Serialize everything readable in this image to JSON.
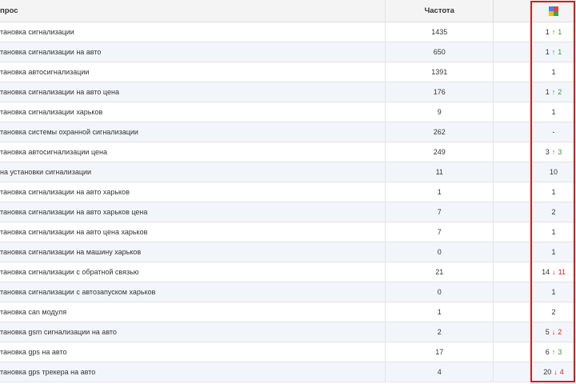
{
  "header": {
    "query_label": "прос",
    "frequency_label": "Частота"
  },
  "colors": {
    "up": "#2e9b2e",
    "down": "#d62020",
    "highlight": "#d71a1a"
  },
  "rows": [
    {
      "query": "тановка сигнализации",
      "freq": "1435",
      "pos": "1",
      "change_dir": "up",
      "change": "1"
    },
    {
      "query": "тановка сигнализации на авто",
      "freq": "650",
      "pos": "1",
      "change_dir": "up",
      "change": "1"
    },
    {
      "query": "тановка автосигнализации",
      "freq": "1391",
      "pos": "1",
      "change_dir": "",
      "change": ""
    },
    {
      "query": "тановка сигнализации на авто цена",
      "freq": "176",
      "pos": "1",
      "change_dir": "up",
      "change": "2"
    },
    {
      "query": "тановка сигнализации харьков",
      "freq": "9",
      "pos": "1",
      "change_dir": "",
      "change": ""
    },
    {
      "query": "тановка системы охранной сигнализации",
      "freq": "262",
      "pos": "-",
      "change_dir": "",
      "change": ""
    },
    {
      "query": "тановка автосигнализации цена",
      "freq": "249",
      "pos": "3",
      "change_dir": "up",
      "change": "3"
    },
    {
      "query": "на установки сигнализации",
      "freq": "11",
      "pos": "10",
      "change_dir": "",
      "change": ""
    },
    {
      "query": "тановка сигнализации на авто харьков",
      "freq": "1",
      "pos": "1",
      "change_dir": "",
      "change": ""
    },
    {
      "query": "тановка сигнализации на авто харьков цена",
      "freq": "7",
      "pos": "2",
      "change_dir": "",
      "change": ""
    },
    {
      "query": "тановка сигнализации на авто цена харьков",
      "freq": "7",
      "pos": "1",
      "change_dir": "",
      "change": ""
    },
    {
      "query": "тановка сигнализации на машину харьков",
      "freq": "0",
      "pos": "1",
      "change_dir": "",
      "change": ""
    },
    {
      "query": "тановка сигнализации с обратной связью",
      "freq": "21",
      "pos": "14",
      "change_dir": "down",
      "change": "11"
    },
    {
      "query": "тановка сигнализации с автозапуском харьков",
      "freq": "0",
      "pos": "1",
      "change_dir": "",
      "change": ""
    },
    {
      "query": "тановка can модуля",
      "freq": "1",
      "pos": "2",
      "change_dir": "",
      "change": ""
    },
    {
      "query": "тановка gsm сигнализации на авто",
      "freq": "2",
      "pos": "5",
      "change_dir": "down",
      "change": "2"
    },
    {
      "query": "тановка gps на авто",
      "freq": "17",
      "pos": "6",
      "change_dir": "up",
      "change": "3"
    },
    {
      "query": "тановка gps трекера на авто",
      "freq": "4",
      "pos": "20",
      "change_dir": "down",
      "change": "4"
    }
  ]
}
